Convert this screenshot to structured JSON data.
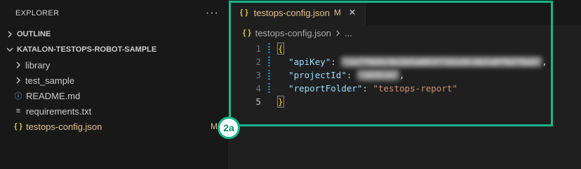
{
  "explorer": {
    "title": "EXPLORER",
    "more_label": "···",
    "outline_label": "OUTLINE",
    "project_label": "KATALON-TESTOPS-ROBOT-SAMPLE",
    "items": [
      {
        "label": "library",
        "kind": "folder"
      },
      {
        "label": "test_sample",
        "kind": "folder"
      },
      {
        "label": "README.md",
        "kind": "file",
        "icon": "info-icon",
        "icon_glyph": "ⓘ"
      },
      {
        "label": "requirements.txt",
        "kind": "file",
        "icon": "lines-icon",
        "icon_glyph": "≡"
      },
      {
        "label": "testops-config.json",
        "kind": "file",
        "icon": "json-icon",
        "icon_glyph": "{ }",
        "badge": "M"
      }
    ]
  },
  "editor": {
    "tab": {
      "icon_glyph": "{ }",
      "label": "testops-config.json",
      "badge": "M",
      "close_glyph": "✕"
    },
    "breadcrumb": {
      "icon_glyph": "{ }",
      "file": "testops-config.json",
      "ellipsis": "..."
    },
    "lines": [
      {
        "num": "1",
        "open": "{"
      },
      {
        "num": "2",
        "key": "\"apiKey\"",
        "colon": ": ",
        "value": "\"1a7f9d4c8e2b5a063f7d1e9c4b2a8f6d70a5\"",
        "value_blurred": true,
        "trail": ","
      },
      {
        "num": "3",
        "key": "\"projectId\"",
        "colon": ": ",
        "value": "\"103516\"",
        "value_blurred": true,
        "trail": ","
      },
      {
        "num": "4",
        "key": "\"reportFolder\"",
        "colon": ": ",
        "value": "\"testops-report\"",
        "trail": ""
      },
      {
        "num": "5",
        "close": "}"
      }
    ]
  },
  "annotation": {
    "step_label": "2a",
    "accent_color": "#14b789"
  }
}
